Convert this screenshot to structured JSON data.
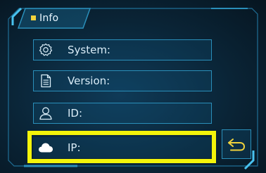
{
  "header": {
    "title": "Info"
  },
  "rows": [
    {
      "label": "System:",
      "icon": "gear-icon"
    },
    {
      "label": "Version:",
      "icon": "document-icon"
    },
    {
      "label": "ID:",
      "icon": "user-icon"
    },
    {
      "label": "IP:",
      "icon": "cloud-icon"
    }
  ],
  "back_button": {
    "icon": "return-arrow-icon"
  },
  "colors": {
    "accent": "#2a8fba",
    "highlight": "#f4f40a",
    "title_marker": "#f0d23c",
    "background": "#0a2436"
  }
}
